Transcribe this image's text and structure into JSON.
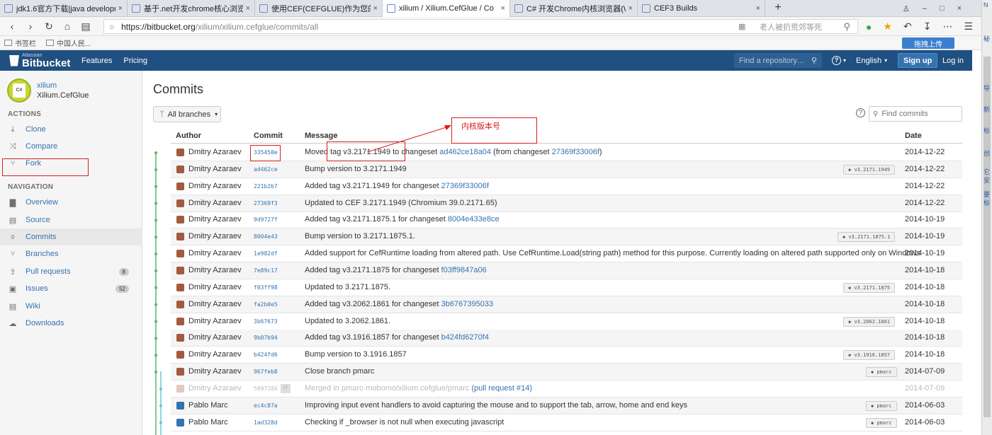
{
  "browser": {
    "tabs": [
      {
        "title": "jdk1.6官方下载|java developme",
        "active": false
      },
      {
        "title": "基于.net开发chrome核心浏览器",
        "active": false
      },
      {
        "title": "使用CEF(CEFGLUE)作为您的客户",
        "active": false
      },
      {
        "title": "xilium / Xilium.CefGlue / Co",
        "active": true
      },
      {
        "title": "C# 开发Chrome内核浏览器(We",
        "active": false
      },
      {
        "title": "CEF3 Builds",
        "active": false
      }
    ],
    "new_tab": "+",
    "url_host": "https://bitbucket.org",
    "url_path": "/xilium/xilium.cefglue/commits/all",
    "search_hint": "老人被扔荒郊等死",
    "bookmarks": [
      "书签栏",
      "中国人民..."
    ],
    "upload_button": "拖拽上传",
    "side_chars": [
      "N",
      "秘",
      "导",
      "新",
      "标",
      "创",
      "它",
      "安",
      "要",
      "标"
    ]
  },
  "header": {
    "logo_small": "Atlassian",
    "logo": "Bitbucket",
    "nav": [
      "Features",
      "Pricing"
    ],
    "search_placeholder": "Find a repository…",
    "help": "?",
    "language": "English",
    "signup": "Sign up",
    "login": "Log in"
  },
  "sidebar": {
    "owner": "xilium",
    "repo": "Xilium.CefGlue",
    "avatar_text": "C#",
    "actions_heading": "ACTIONS",
    "actions": [
      {
        "label": "Clone",
        "icon": "download-icon"
      },
      {
        "label": "Compare",
        "icon": "shuffle-icon"
      },
      {
        "label": "Fork",
        "icon": "fork-icon"
      }
    ],
    "navigation_heading": "NAVIGATION",
    "navigation": [
      {
        "label": "Overview",
        "icon": "chart-icon",
        "badge": ""
      },
      {
        "label": "Source",
        "icon": "file-icon",
        "badge": ""
      },
      {
        "label": "Commits",
        "icon": "commit-icon",
        "badge": "",
        "selected": true
      },
      {
        "label": "Branches",
        "icon": "branch-icon",
        "badge": ""
      },
      {
        "label": "Pull requests",
        "icon": "pull-request-icon",
        "badge": "8"
      },
      {
        "label": "Issues",
        "icon": "issue-icon",
        "badge": "52"
      },
      {
        "label": "Wiki",
        "icon": "wiki-icon",
        "badge": ""
      },
      {
        "label": "Downloads",
        "icon": "cloud-icon",
        "badge": ""
      }
    ]
  },
  "main": {
    "title": "Commits",
    "branch_filter": "All branches",
    "find_placeholder": "Find commits",
    "columns": {
      "author": "Author",
      "commit": "Commit",
      "message": "Message",
      "date": "Date"
    },
    "annotation": "内核版本号",
    "rows": [
      {
        "author": "Dmitry Azaraev",
        "hash": "335450e",
        "msg": "Moved tag v3.2171.1949 to changeset ",
        "link1": "ad462ce18a04",
        "mid": " (from changeset ",
        "link2": "27369f33006f",
        "end": ")",
        "tag": "",
        "date": "2014-12-22"
      },
      {
        "author": "Dmitry Azaraev",
        "hash": "ad462ce",
        "msg": "Bump version to 3.2171.1949",
        "link1": "",
        "mid": "",
        "link2": "",
        "end": "",
        "tag": "v3.2171.1949",
        "date": "2014-12-22"
      },
      {
        "author": "Dmitry Azaraev",
        "hash": "221b2b7",
        "msg": "Added tag v3.2171.1949 for changeset ",
        "link1": "27369f33006f",
        "mid": "",
        "link2": "",
        "end": "",
        "tag": "",
        "date": "2014-12-22"
      },
      {
        "author": "Dmitry Azaraev",
        "hash": "27369f3",
        "msg": "Updated to CEF 3.2171.1949 (Chromium 39.0.2171.65)",
        "link1": "",
        "mid": "",
        "link2": "",
        "end": "",
        "tag": "",
        "date": "2014-12-22"
      },
      {
        "author": "Dmitry Azaraev",
        "hash": "9d9727f",
        "msg": "Added tag v3.2171.1875.1 for changeset ",
        "link1": "8004e433e8ce",
        "mid": "",
        "link2": "",
        "end": "",
        "tag": "",
        "date": "2014-10-19"
      },
      {
        "author": "Dmitry Azaraev",
        "hash": "8004e43",
        "msg": "Bump version to 3.2171.1875.1.",
        "link1": "",
        "mid": "",
        "link2": "",
        "end": "",
        "tag": "v3.2171.1875.1",
        "date": "2014-10-19"
      },
      {
        "author": "Dmitry Azaraev",
        "hash": "1e982df",
        "msg": "Added support for CefRuntime loading from altered path. Use CefRuntime.Load(string path) method for this purpose. Currently loading on altered path supported only on Windows",
        "link1": "",
        "mid": "",
        "link2": "",
        "end": "",
        "tag": "",
        "date": "2014-10-19"
      },
      {
        "author": "Dmitry Azaraev",
        "hash": "7e89c17",
        "msg": "Added tag v3.2171.1875 for changeset ",
        "link1": "f03ff9847a06",
        "mid": "",
        "link2": "",
        "end": "",
        "tag": "",
        "date": "2014-10-18"
      },
      {
        "author": "Dmitry Azaraev",
        "hash": "f03ff98",
        "msg": "Updated to 3.2171.1875.",
        "link1": "",
        "mid": "",
        "link2": "",
        "end": "",
        "tag": "v3.2171.1875",
        "date": "2014-10-18"
      },
      {
        "author": "Dmitry Azaraev",
        "hash": "fa2b0e5",
        "msg": "Added tag v3.2062.1861 for changeset ",
        "link1": "3b6767395033",
        "mid": "",
        "link2": "",
        "end": "",
        "tag": "",
        "date": "2014-10-18"
      },
      {
        "author": "Dmitry Azaraev",
        "hash": "3b67673",
        "msg": "Updated to 3.2062.1861.",
        "link1": "",
        "mid": "",
        "link2": "",
        "end": "",
        "tag": "v3.2062.1861",
        "date": "2014-10-18"
      },
      {
        "author": "Dmitry Azaraev",
        "hash": "9b07b94",
        "msg": "Added tag v3.1916.1857 for changeset ",
        "link1": "b424fd6270f4",
        "mid": "",
        "link2": "",
        "end": "",
        "tag": "",
        "date": "2014-10-18"
      },
      {
        "author": "Dmitry Azaraev",
        "hash": "b424fd6",
        "msg": "Bump version to 3.1916.1857",
        "link1": "",
        "mid": "",
        "link2": "",
        "end": "",
        "tag": "v3.1916.1857",
        "date": "2014-10-18"
      },
      {
        "author": "Dmitry Azaraev",
        "hash": "967feb8",
        "msg": "Close branch pmarc",
        "link1": "",
        "mid": "",
        "link2": "",
        "end": "",
        "tag": "pmarc",
        "date": "2014-07-09"
      },
      {
        "author": "Dmitry Azaraev",
        "hash": "5897284",
        "badge": "M",
        "msg": "Merged in pmarc-mobomo/xilium.cefglue/pmarc ",
        "link1": "(pull request #14)",
        "mid": "",
        "link2": "",
        "end": "",
        "tag": "",
        "date": "2014-07-09",
        "faded": true
      },
      {
        "author": "Pablo Marc",
        "hash": "ec4c87a",
        "msg": "Improving input event handlers to avoid capturing the mouse and to support the tab, arrow, home and end keys",
        "link1": "",
        "mid": "",
        "link2": "",
        "end": "",
        "tag": "pmarc",
        "date": "2014-06-03"
      },
      {
        "author": "Pablo Marc",
        "hash": "1ad328d",
        "msg": "Checking if _browser is not null when executing javascript",
        "link1": "",
        "mid": "",
        "link2": "",
        "end": "",
        "tag": "pmarc",
        "date": "2014-06-03"
      }
    ]
  }
}
